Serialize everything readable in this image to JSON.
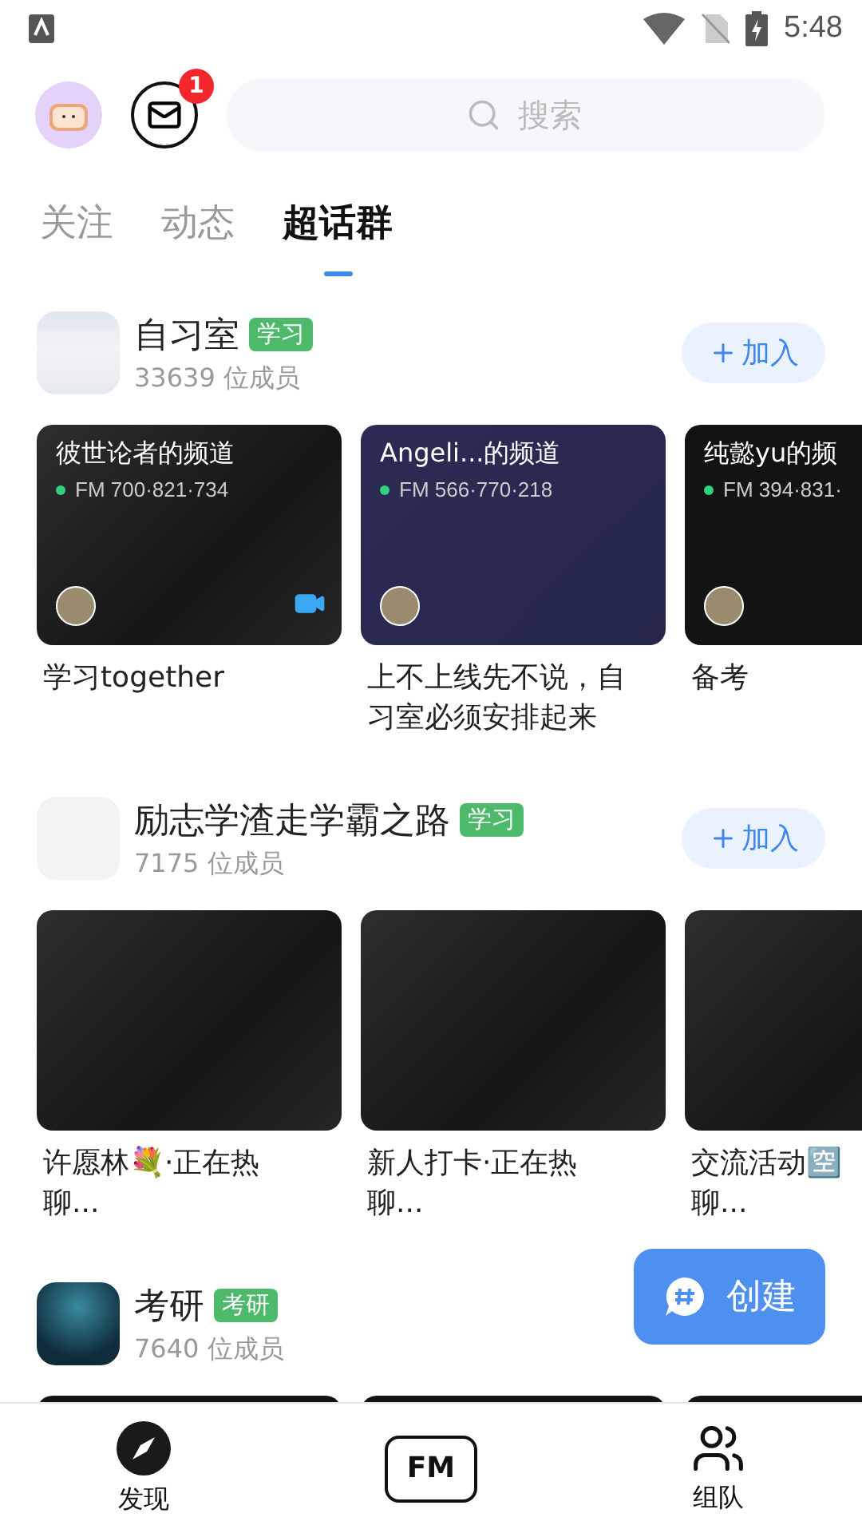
{
  "status_bar": {
    "time": "5:48"
  },
  "header": {
    "mail_badge": "1",
    "search": {
      "placeholder": "搜索"
    }
  },
  "tabs": [
    {
      "label": "关注",
      "selected": false
    },
    {
      "label": "动态",
      "selected": false
    },
    {
      "label": "超话群",
      "selected": true
    }
  ],
  "groups": [
    {
      "name": "自习室",
      "tag": "学习",
      "members": "33639 位成员",
      "join": "加入",
      "cards": [
        {
          "kind": "photo",
          "title": "彼世论者的频道",
          "fm": "FM 700·821·734",
          "video": true,
          "caption": "学习together"
        },
        {
          "kind": "navy",
          "title": "Angeli...的频道",
          "fm": "FM 566·770·218",
          "video": false,
          "caption": "上不上线先不说，自习室必须安排起来"
        },
        {
          "kind": "black",
          "title": "纯懿yu的频",
          "fm": "FM 394·831·",
          "caption": "备考"
        }
      ]
    },
    {
      "name": "励志学渣走学霸之路",
      "tag": "学习",
      "members": "7175 位成员",
      "join": "加入",
      "cards": [
        {
          "kind": "photo",
          "caption": [
            "许愿林💐·正在热",
            "聊..."
          ]
        },
        {
          "kind": "photo",
          "caption": [
            "新人打卡·正在热",
            "聊..."
          ]
        },
        {
          "kind": "photo",
          "caption": [
            "交流活动🈳",
            "聊..."
          ]
        }
      ]
    },
    {
      "name": "考研",
      "tag": "考研",
      "members": "7640 位成员",
      "cards": [
        {
          "kind": "black"
        },
        {
          "kind": "black"
        },
        {
          "kind": "black"
        }
      ]
    }
  ],
  "create_button": {
    "label": "创建"
  },
  "bottom_nav": [
    {
      "kind": "discover",
      "label": "发现"
    },
    {
      "kind": "fm",
      "label": "FM"
    },
    {
      "kind": "team",
      "label": "组队"
    }
  ]
}
